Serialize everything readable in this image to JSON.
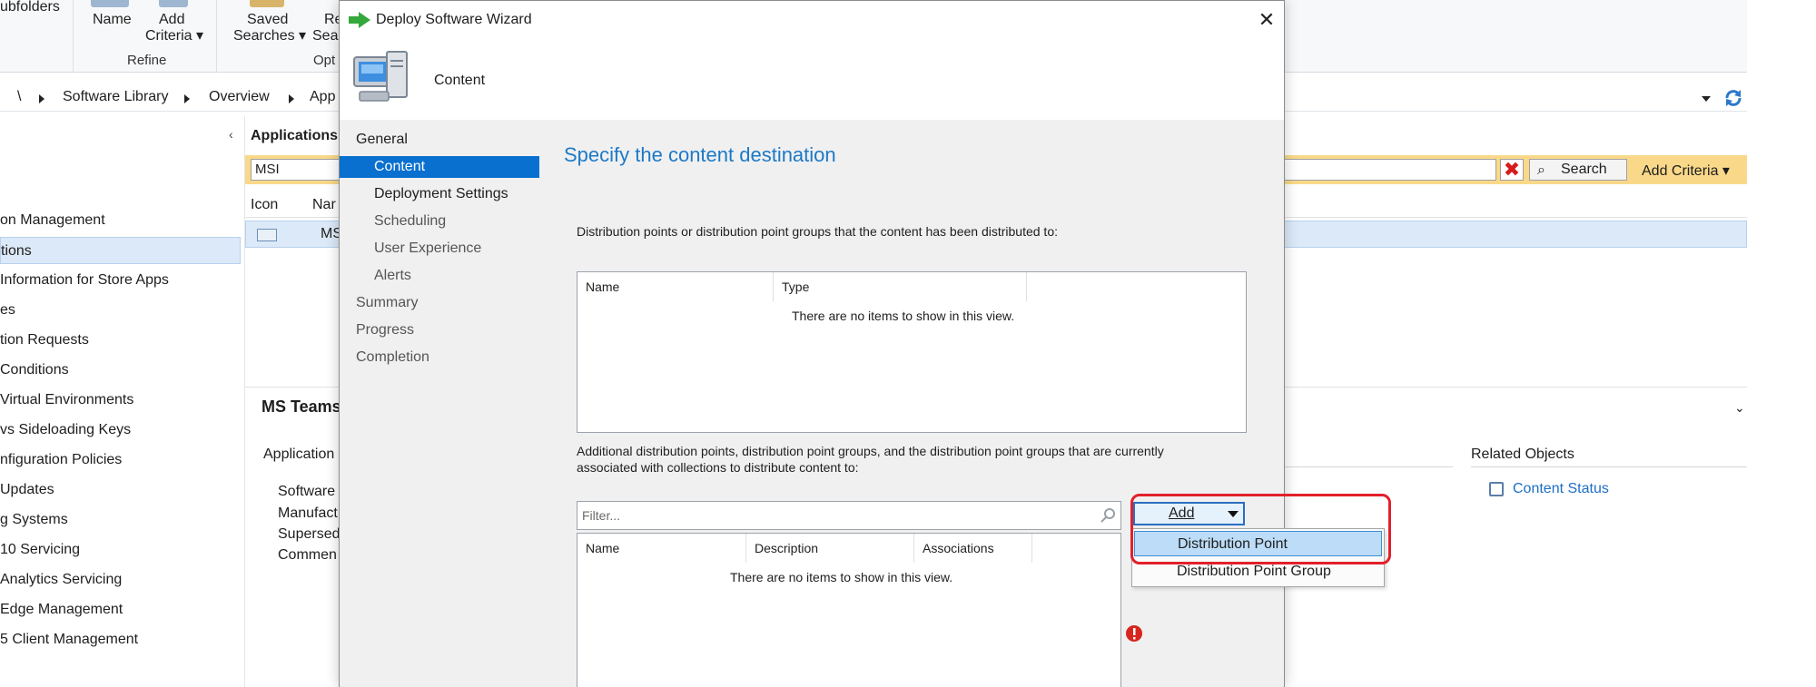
{
  "ribbon": {
    "subfolders_label": "ubfolders",
    "name_label": "Name",
    "add_criteria_label_1": "Add",
    "add_criteria_label_2": "Criteria ▾",
    "saved_searches_label_1": "Saved",
    "saved_searches_label_2": "Searches ▾",
    "re_label_1": "Re",
    "re_label_2": "Sea",
    "refine_group": "Refine",
    "options_group": "Opt"
  },
  "address_bar": {
    "root": "\\",
    "crumbs": [
      "Software Library",
      "Overview",
      "App"
    ]
  },
  "nav": {
    "items": [
      "on Management",
      "tions",
      " Information for Store Apps",
      "es",
      "tion Requests",
      "Conditions",
      "Virtual Environments",
      "vs Sideloading Keys",
      "nfiguration Policies",
      "Updates",
      "g Systems",
      "10 Servicing",
      "Analytics Servicing",
      "Edge Management",
      "5 Client Management"
    ]
  },
  "list": {
    "title": "Applications",
    "search_value": "MSI",
    "search_button": "Search",
    "add_criteria_button": "Add Criteria ▾",
    "columns": [
      "Icon",
      "Nar"
    ],
    "row_name": "MS",
    "details_title": "MS Teams",
    "details_section": "Application",
    "details_fields": [
      "Software",
      "Manufact",
      "Supersed",
      "Commen"
    ],
    "related_objects_label": "Related Objects",
    "content_status_link": "Content Status"
  },
  "wizard": {
    "title": "Deploy Software Wizard",
    "subtitle": "Content",
    "close_glyph": "✕",
    "steps": [
      {
        "label": "General",
        "level": "main",
        "active": false
      },
      {
        "label": "Content",
        "level": "sub",
        "active": true
      },
      {
        "label": "Deployment Settings",
        "level": "sub",
        "active": false,
        "bold": true
      },
      {
        "label": "Scheduling",
        "level": "sub",
        "active": false
      },
      {
        "label": "User Experience",
        "level": "sub",
        "active": false
      },
      {
        "label": "Alerts",
        "level": "sub",
        "active": false
      },
      {
        "label": "Summary",
        "level": "main",
        "active": false
      },
      {
        "label": "Progress",
        "level": "main",
        "active": false
      },
      {
        "label": "Completion",
        "level": "main",
        "active": false
      }
    ],
    "page_heading": "Specify the content destination",
    "distributed_label": "Distribution points or distribution point groups that the content has been distributed to:",
    "list1_columns": [
      "Name",
      "Type"
    ],
    "empty_message": "There are no items to show in this view.",
    "additional_label_1": "Additional distribution points, distribution point groups, and the distribution point groups that are currently",
    "additional_label_2": "associated with collections to distribute content to:",
    "filter_placeholder": "Filter...",
    "list2_columns": [
      "Name",
      "Description",
      "Associations"
    ],
    "add_button": "Add",
    "add_menu": [
      "Distribution Point",
      "Distribution Point Group"
    ]
  },
  "colors": {
    "accent_blue": "#1c79c7",
    "selection_blue": "#0a70d0",
    "callout_red": "#e2202b",
    "search_bar_yellow": "#f7d37a"
  }
}
